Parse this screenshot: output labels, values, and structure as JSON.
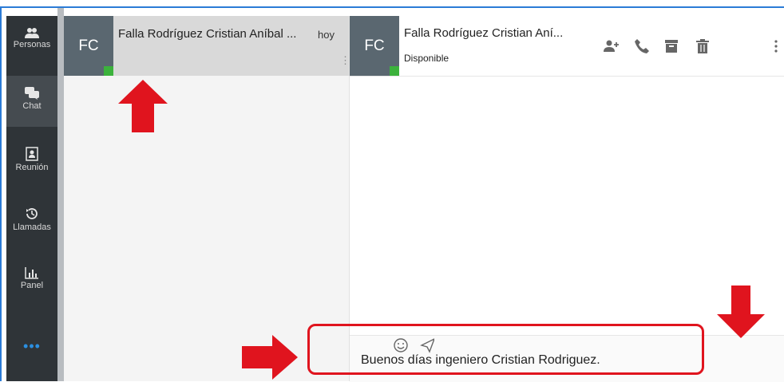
{
  "sidebar": {
    "items": [
      {
        "label": "Personas",
        "icon": "people-icon"
      },
      {
        "label": "Chat",
        "icon": "chat-icon"
      },
      {
        "label": "Reunión",
        "icon": "meeting-icon"
      },
      {
        "label": "Llamadas",
        "icon": "history-icon"
      },
      {
        "label": "Panel",
        "icon": "chart-icon"
      }
    ],
    "more_label": "•••"
  },
  "conversation_list": {
    "items": [
      {
        "initials": "FC",
        "name": "Falla Rodríguez Cristian Aníbal ...",
        "time": "hoy",
        "presence": "#3cb23c"
      }
    ]
  },
  "chat": {
    "header": {
      "initials": "FC",
      "name": "Falla Rodríguez Cristian Aní...",
      "status": "Disponible",
      "actions": [
        "add-person-icon",
        "phone-icon",
        "archive-icon",
        "trash-icon",
        "more-vertical-icon"
      ]
    },
    "composer": {
      "text": "Buenos días ingeniero Cristian Rodriguez."
    }
  },
  "colors": {
    "sidebar": "#2f3438",
    "avatar": "#5a6770",
    "presence": "#3cb23c",
    "annotation": "#e0141e"
  }
}
